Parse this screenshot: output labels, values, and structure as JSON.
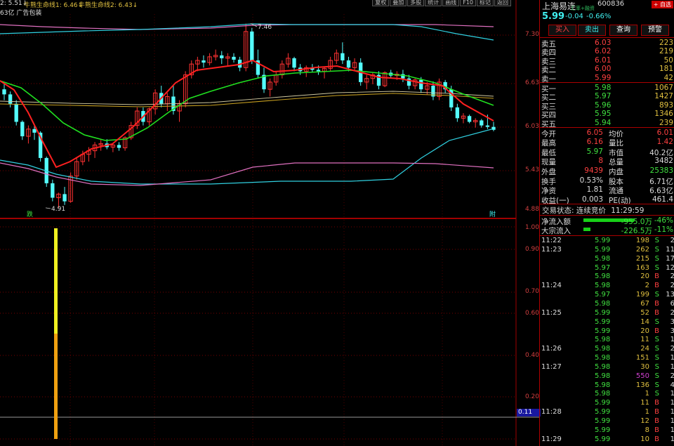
{
  "header": {
    "ma_text_1": "2: 5.51↓",
    "ma_text_2": "牛熊生命线1: 6.46↓",
    "ma_text_3": "牛熊生命线2: 6.43↓",
    "line2": "63亿 广告包装",
    "tools": [
      "复权",
      "叠加",
      "多股",
      "统计",
      "画线",
      "F10",
      "标记",
      "返回"
    ]
  },
  "price_axis": [
    "7.30",
    "6.63",
    "6.03",
    "5.43",
    "4.88"
  ],
  "indicator_axis": [
    "1.00",
    "0.90",
    "0.70",
    "0.60",
    "0.40",
    "0.20"
  ],
  "current_indicator": "0.11",
  "annotations": {
    "high": "7.46",
    "low": "4.91",
    "left_tag": "跌",
    "right_tag": "附"
  },
  "stock": {
    "name": "上海易连",
    "code": "600836",
    "tag": "+ 自选",
    "price": "5.99",
    "change": "-0.04",
    "pct": "-0.66%",
    "badge": "汇率+融资"
  },
  "buttons": [
    "买入",
    "卖出",
    "查询",
    "预警"
  ],
  "order_book": {
    "sells": [
      {
        "label": "卖五",
        "price": "6.03",
        "vol": "223"
      },
      {
        "label": "卖四",
        "price": "6.02",
        "vol": "219"
      },
      {
        "label": "卖三",
        "price": "6.01",
        "vol": "50"
      },
      {
        "label": "卖二",
        "price": "6.00",
        "vol": "181"
      },
      {
        "label": "卖一",
        "price": "5.99",
        "vol": "42"
      }
    ],
    "buys": [
      {
        "label": "买一",
        "price": "5.98",
        "vol": "1067"
      },
      {
        "label": "买二",
        "price": "5.97",
        "vol": "1427"
      },
      {
        "label": "买三",
        "price": "5.96",
        "vol": "893"
      },
      {
        "label": "买四",
        "price": "5.95",
        "vol": "1346"
      },
      {
        "label": "买五",
        "price": "5.94",
        "vol": "239"
      }
    ]
  },
  "stats": [
    {
      "l1": "今开",
      "v1": "6.05",
      "l2": "均价",
      "v2": "6.01"
    },
    {
      "l1": "最高",
      "v1": "6.16",
      "l2": "量比",
      "v2": "1.42"
    },
    {
      "l1": "最低",
      "v1": "5.97",
      "l2": "市值",
      "v2": "40.2亿"
    },
    {
      "l1": "现量",
      "v1": "8",
      "l2": "总量",
      "v2": "3482"
    },
    {
      "l1": "外盘",
      "v1": "9439",
      "l2": "内盘",
      "v2": "25383"
    },
    {
      "l1": "换手",
      "v1": "0.53%",
      "l2": "股本",
      "v2": "6.71亿"
    },
    {
      "l1": "净资",
      "v1": "1.81",
      "l2": "流通",
      "v2": "6.63亿"
    },
    {
      "l1": "收益(一)",
      "v1": "0.003",
      "l2": "PE(动)",
      "v2": "461.4"
    }
  ],
  "trade_status": {
    "label": "交易状态:",
    "value": "连续竞价",
    "time": "11:29:59"
  },
  "flow": [
    {
      "label": "净流入额",
      "value": "-955.0万",
      "pct": "-46%"
    },
    {
      "label": "大宗流入",
      "value": "-226.5万",
      "pct": "-11%"
    }
  ],
  "ticks": [
    {
      "t": "11:22",
      "p": "5.99",
      "v": "198",
      "d": "S",
      "n": "2"
    },
    {
      "t": "11:23",
      "p": "5.99",
      "v": "262",
      "d": "S",
      "n": "11"
    },
    {
      "t": "",
      "p": "5.98",
      "v": "215",
      "d": "S",
      "n": "17"
    },
    {
      "t": "",
      "p": "5.97",
      "v": "163",
      "d": "S",
      "n": "12"
    },
    {
      "t": "",
      "p": "5.98",
      "v": "20",
      "d": "B",
      "n": "2"
    },
    {
      "t": "11:24",
      "p": "5.98",
      "v": "2",
      "d": "B",
      "n": "2"
    },
    {
      "t": "",
      "p": "5.97",
      "v": "199",
      "d": "S",
      "n": "13"
    },
    {
      "t": "",
      "p": "5.98",
      "v": "67",
      "d": "B",
      "n": "6"
    },
    {
      "t": "11:25",
      "p": "5.99",
      "v": "52",
      "d": "B",
      "n": "2"
    },
    {
      "t": "",
      "p": "5.99",
      "v": "14",
      "d": "S",
      "n": "3"
    },
    {
      "t": "",
      "p": "5.99",
      "v": "20",
      "d": "B",
      "n": "3"
    },
    {
      "t": "",
      "p": "5.98",
      "v": "11",
      "d": "S",
      "n": "1"
    },
    {
      "t": "11:26",
      "p": "5.98",
      "v": "24",
      "d": "S",
      "n": "2"
    },
    {
      "t": "",
      "p": "5.98",
      "v": "151",
      "d": "S",
      "n": "1"
    },
    {
      "t": "11:27",
      "p": "5.98",
      "v": "30",
      "d": "S",
      "n": "1"
    },
    {
      "t": "",
      "p": "5.98",
      "v": "550",
      "d": "S",
      "n": "2"
    },
    {
      "t": "",
      "p": "5.98",
      "v": "136",
      "d": "S",
      "n": "4"
    },
    {
      "t": "",
      "p": "5.98",
      "v": "1",
      "d": "S",
      "n": "1"
    },
    {
      "t": "",
      "p": "5.99",
      "v": "11",
      "d": "B",
      "n": "1"
    },
    {
      "t": "11:28",
      "p": "5.99",
      "v": "1",
      "d": "B",
      "n": "1"
    },
    {
      "t": "",
      "p": "5.99",
      "v": "12",
      "d": "B",
      "n": "1"
    },
    {
      "t": "",
      "p": "5.99",
      "v": "8",
      "d": "B",
      "n": "1"
    },
    {
      "t": "11:29",
      "p": "5.99",
      "v": "10",
      "d": "B",
      "n": "1"
    }
  ],
  "colors": {
    "up": "#ff3232",
    "down": "#54fcfc",
    "ma_red": "#ff2020",
    "ma_green": "#20e020",
    "ma_gold": "#c8a020",
    "band_cyan": "#30d0e0",
    "band_pink": "#e070c0",
    "grid": "#a00000"
  }
}
